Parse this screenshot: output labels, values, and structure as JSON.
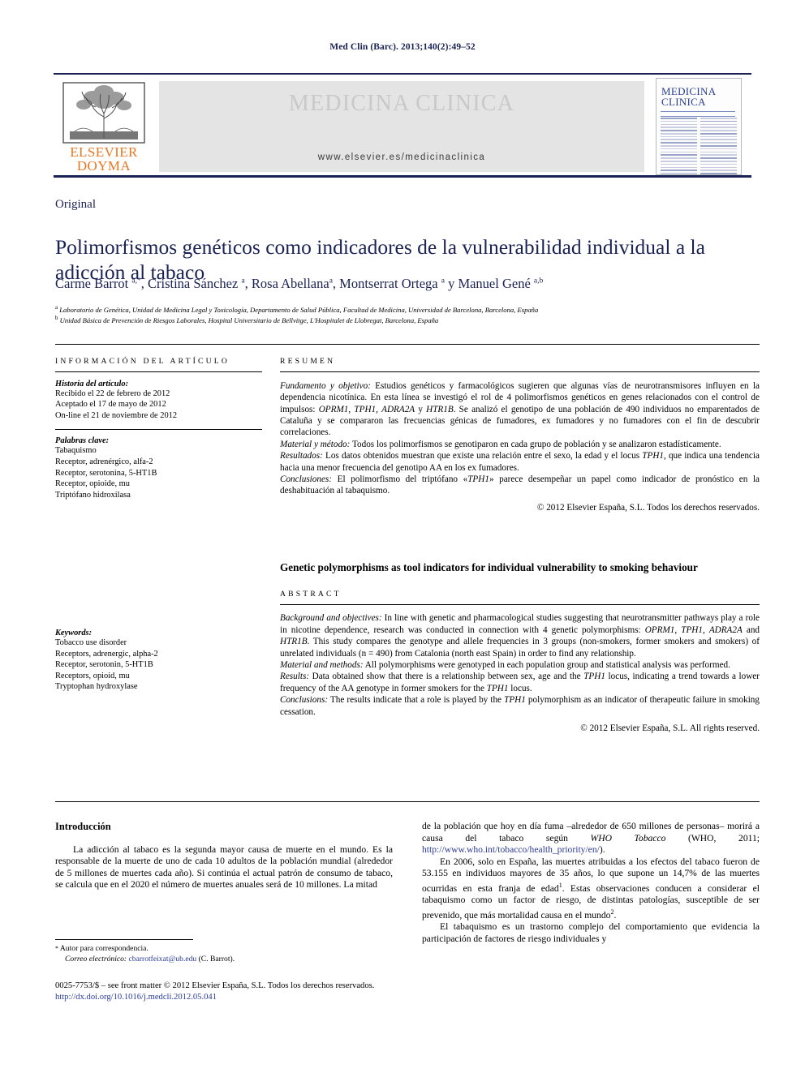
{
  "running_head": "Med Clin (Barc). 2013;140(2):49–52",
  "masthead": {
    "publisher_line1": "ELSEVIER",
    "publisher_line2": "DOYMA",
    "journal_name": "MEDICINA CLINICA",
    "url": "www.elsevier.es/medicinaclinica",
    "cover_title_line1": "MEDICINA",
    "cover_title_line2": "CLINICA"
  },
  "article": {
    "type": "Original",
    "title": "Polimorfismos genéticos como indicadores de la vulnerabilidad individual a la adicción al tabaco",
    "authors_html": "Carme Barrot <sup>a,</sup><sup>*</sup>, Cristina Sánchez <sup>a</sup>, Rosa Abellana<sup>a</sup>, Montserrat Ortega <sup>a</sup> y Manuel Gené <sup>a,b</sup>",
    "affiliation_a": "Laboratorio de Genética, Unidad de Medicina Legal y Toxicología, Departamento de Salud Pública, Facultad de Medicina, Universidad de Barcelona, Barcelona, España",
    "affiliation_b": "Unidad Básica de Prevención de Riesgos Laborales, Hospital Universitario de Bellvitge, L'Hospitalet de Llobregat, Barcelona, España"
  },
  "info_panel": {
    "heading": "INFORMACIÓN DEL ARTÍCULO",
    "history_label": "Historia del artículo:",
    "history": [
      "Recibido el 22 de febrero de 2012",
      "Aceptado el 17 de mayo de 2012",
      "On-line el 21 de noviembre de 2012"
    ],
    "keywords_es_label": "Palabras clave:",
    "keywords_es": [
      "Tabaquismo",
      "Receptor, adrenérgico, alfa-2",
      "Receptor, serotonina, 5-HT1B",
      "Receptor, opioide, mu",
      "Triptófano hidroxilasa"
    ],
    "keywords_en_label": "Keywords:",
    "keywords_en": [
      "Tobacco use disorder",
      "Receptors, adrenergic, alpha-2",
      "Receptor, serotonin, 5-HT1B",
      "Receptors, opioid, mu",
      "Tryptophan hydroxylase"
    ]
  },
  "resumen": {
    "heading": "RESUMEN",
    "p1_html": "<i>Fundamento y objetivo:</i> Estudios genéticos y farmacológicos sugieren que algunas vías de neurotransmisores influyen en la dependencia nicotínica. En esta línea se investigó el rol de 4 polimorfismos genéticos en genes relacionados con el control de impulsos: <i>OPRM1</i>, <i>TPH1</i>, <i>ADRA2A</i> y <i>HTR1B</i>. Se analizó el genotipo de una población de 490 individuos no emparentados de Cataluña y se compararon las frecuencias génicas de fumadores, ex fumadores y no fumadores con el fin de descubrir correlaciones.",
    "p2_html": "<i>Material y método:</i> Todos los polimorfismos se genotiparon en cada grupo de población y se analizaron estadísticamente.",
    "p3_html": "<i>Resultados:</i> Los datos obtenidos muestran que existe una relación entre el sexo, la edad y el locus <i>TPH1</i>, que indica una tendencia hacia una menor frecuencia del genotipo AA en los ex fumadores.",
    "p4_html": "<i>Conclusiones:</i> El polimorfismo del triptófano «<i>TPH1</i>» parece desempeñar un papel como indicador de pronóstico en la deshabituación al tabaquismo.",
    "copyright": "© 2012 Elsevier España, S.L. Todos los derechos reservados."
  },
  "abstract": {
    "title": "Genetic polymorphisms as tool indicators for individual vulnerability to smoking behaviour",
    "heading": "ABSTRACT",
    "p1_html": "<i>Background and objectives:</i> In line with genetic and pharmacological studies suggesting that neurotransmitter pathways play a role in nicotine dependence, research was conducted in connection with 4 genetic polymorphisms: <i>OPRM1</i>, <i>TPH1</i>, <i>ADRA2A</i> and <i>HTR1B</i>. This study compares the genotype and allele frequencies in 3 groups (non-smokers, former smokers and smokers) of unrelated individuals (n = 490) from Catalonia (north east Spain) in order to find any relationship.",
    "p2_html": "<i>Material and methods:</i> All polymorphisms were genotyped in each population group and statistical analysis was performed.",
    "p3_html": "<i>Results:</i> Data obtained show that there is a relationship between sex, age and the <i>TPH1</i> locus, indicating a trend towards a lower frequency of the AA genotype in former smokers for the <i>TPH1</i> locus.",
    "p4_html": "<i>Conclusions:</i> The results indicate that a role is played by the <i>TPH1</i> polymorphism as an indicator of therapeutic failure in smoking cessation.",
    "copyright": "© 2012 Elsevier España, S.L. All rights reserved."
  },
  "introduction": {
    "heading": "Introducción",
    "left_p1": "La adicción al tabaco es la segunda mayor causa de muerte en el mundo. Es la responsable de la muerte de uno de cada 10 adultos de la población mundial (alrededor de 5 millones de muertes cada año). Si continúa el actual patrón de consumo de tabaco, se calcula que en el 2020 el número de muertes anuales será de 10 millones. La mitad",
    "right_p1_html": "de la población que hoy en día fuma –alrededor de 650 millones de personas– morirá a causa del tabaco según <i>WHO Tobacco</i> (WHO, 2011; <a class=\"link\" href=\"#\">http://www.who.int/tobacco/health_priority/en/</a>).",
    "right_p2_html": "En 2006, solo en España, las muertes atribuidas a los efectos del tabaco fueron de 53.155 en individuos mayores de 35 años, lo que supone un 14,7% de las muertes ocurridas en esta franja de edad<sup>1</sup>. Estas observaciones conducen a considerar el tabaquismo como un factor de riesgo, de distintas patologías, susceptible de ser prevenido, que más mortalidad causa en el mundo<sup>2</sup>.",
    "right_p3_html": "El tabaquismo es un trastorno complejo del comportamiento que evidencia la participación de factores de riesgo individuales y"
  },
  "footnote": {
    "star": "*",
    "corresponding": "Autor para correspondencia.",
    "email_label": "Correo electrónico:",
    "email": "cbarrotfeixat@ub.edu",
    "email_suffix": "(C. Barrot)."
  },
  "footer": {
    "issn_line": "0025-7753/$ – see front matter © 2012 Elsevier España, S.L. Todos los derechos reservados.",
    "doi": "http://dx.doi.org/10.1016/j.medcli.2012.05.041"
  },
  "colors": {
    "heading_blue": "#1a2255",
    "link_blue": "#2a3a9a",
    "elsevier_orange": "#e87722",
    "banner_gray": "#e4e4e4"
  }
}
